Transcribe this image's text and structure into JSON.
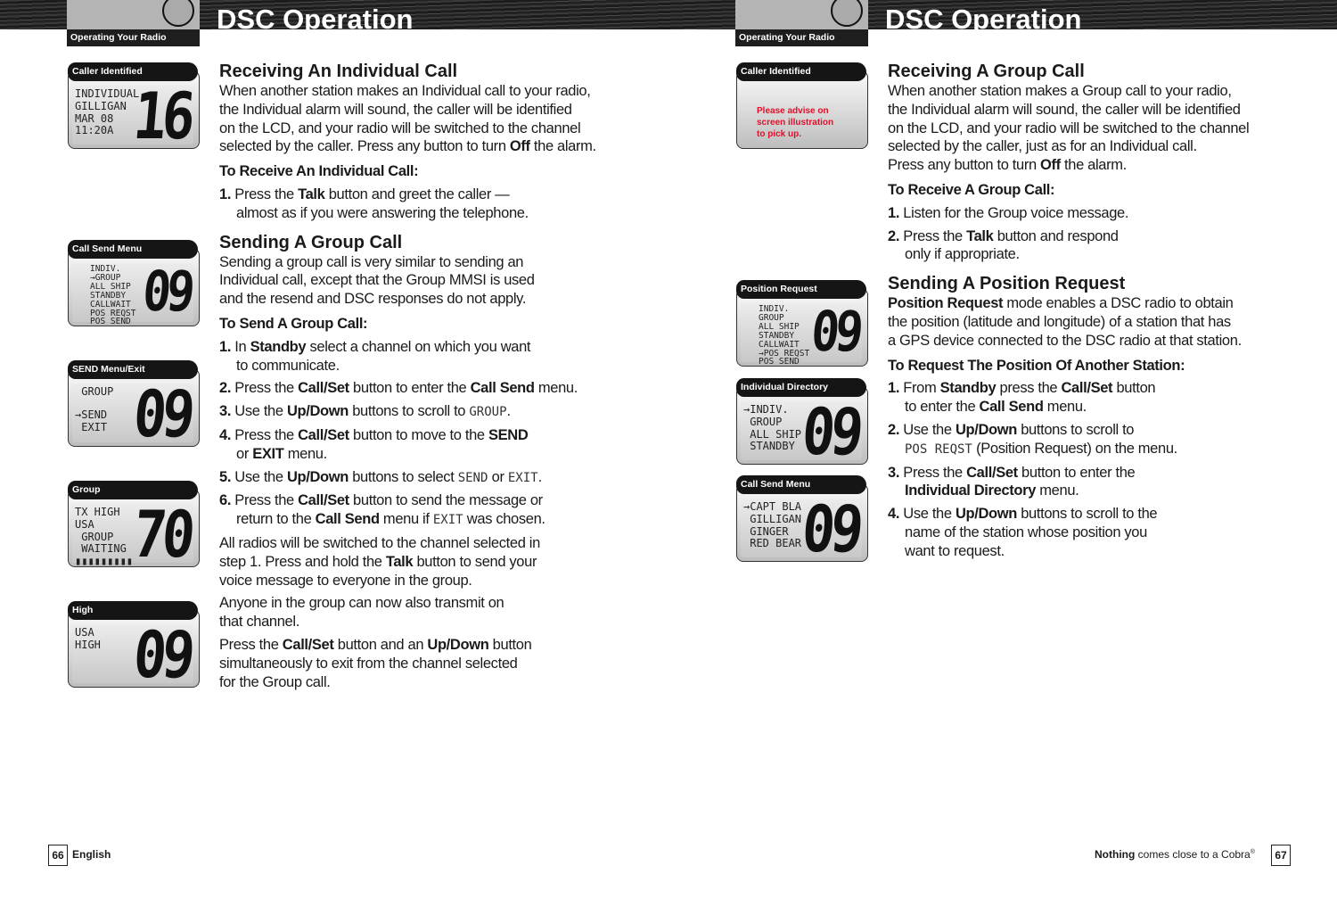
{
  "header": {
    "section_tab": "Operating Your Radio",
    "title": "DSC Operation"
  },
  "left": {
    "panels": [
      {
        "label": "Caller Identified",
        "lines": [
          "INDIVIDUAL",
          "GILLIGAN",
          "MAR 08",
          "11:20A"
        ],
        "channel": "16"
      },
      {
        "label": "Call Send Menu",
        "lines": [
          "INDIV.",
          "→GROUP",
          "ALL SHIP",
          "STANDBY",
          "CALLWAIT",
          "POS REQST",
          "POS SEND"
        ],
        "channel": "09"
      },
      {
        "label": "SEND Menu/Exit",
        "lines": [
          " GROUP",
          "",
          "→SEND",
          " EXIT"
        ],
        "channel": "09"
      },
      {
        "label": "Group",
        "lines": [
          "TX HIGH",
          "USA",
          " GROUP",
          " WAITING",
          "▮▮▮▮▮▮▮▮▮"
        ],
        "channel": "70"
      },
      {
        "label": "High",
        "lines": [
          "USA",
          "HIGH"
        ],
        "channel": "09"
      }
    ],
    "blocks": [
      {
        "type": "h",
        "text": "Receiving An Individual Call"
      },
      {
        "type": "p",
        "lines": [
          "When another station makes an Individual call to your radio,",
          "the Individual alarm will sound, the caller will be identified",
          "on the LCD, and your radio will be switched to the channel",
          "selected by the caller. Press any button to turn **Off** the alarm."
        ]
      },
      {
        "type": "sub",
        "text": "To Receive An Individual Call:"
      },
      {
        "type": "step",
        "lines": [
          "**1.** Press the **Talk** button and greet the caller —",
          "almost as if you were answering the telephone."
        ]
      },
      {
        "type": "h",
        "text": "Sending A Group Call"
      },
      {
        "type": "p",
        "lines": [
          "Sending a group call is very similar to sending an",
          "Individual call, except that the Group MMSI is used",
          "and the resend and DSC responses do not apply."
        ]
      },
      {
        "type": "sub",
        "text": "To Send A Group Call:"
      },
      {
        "type": "step",
        "lines": [
          "**1.** In **Standby** select a channel on which you want",
          "to communicate."
        ]
      },
      {
        "type": "step",
        "lines": [
          "**2.** Press the **Call/Set** button to enter the **Call Send** menu."
        ]
      },
      {
        "type": "step",
        "lines": [
          "**3.** Use the **Up/Down** buttons to scroll to `GROUP`."
        ]
      },
      {
        "type": "step",
        "lines": [
          "**4.** Press the **Call/Set** button to move to the **SEND**",
          "or **EXIT** menu."
        ]
      },
      {
        "type": "step",
        "lines": [
          "**5.** Use the **Up/Down** buttons to select `SEND` or `EXIT`."
        ]
      },
      {
        "type": "step",
        "lines": [
          "**6.** Press the **Call/Set** button to send the message or",
          "return to the **Call Send** menu if `EXIT` was chosen."
        ]
      },
      {
        "type": "p",
        "lines": [
          "All radios will be switched to the channel selected in",
          "step 1. Press and hold the **Talk** button to send your",
          "voice message to everyone in the group."
        ]
      },
      {
        "type": "p",
        "lines": [
          "Anyone in the group can now also transmit on",
          "that channel."
        ]
      },
      {
        "type": "p",
        "lines": [
          "Press the **Call/Set** button and an **Up/Down** button",
          "simultaneously to exit from the channel selected",
          "for the Group call."
        ]
      }
    ],
    "footer": {
      "page": "66",
      "language": "English"
    }
  },
  "right": {
    "panels": [
      {
        "label": "Caller Identified",
        "note": [
          "Please advise on",
          "screen illustration",
          "to pick up."
        ]
      },
      {
        "label": "Position Request",
        "lines": [
          "INDIV.",
          "GROUP",
          "ALL SHIP",
          "STANDBY",
          "CALLWAIT",
          "→POS REQST",
          "POS SEND"
        ],
        "channel": "09"
      },
      {
        "label": "Individual Directory",
        "lines": [
          "→INDIV.",
          " GROUP",
          " ALL SHIP",
          " STANDBY"
        ],
        "channel": "09"
      },
      {
        "label": "Call Send Menu",
        "lines": [
          "→CAPT BLA",
          " GILLIGAN",
          " GINGER",
          " RED BEAR"
        ],
        "channel": "09"
      }
    ],
    "blocks": [
      {
        "type": "h",
        "text": "Receiving A Group Call"
      },
      {
        "type": "p",
        "lines": [
          "When another station makes a Group call to your radio,",
          "the Individual alarm will sound, the caller will be identified",
          "on the LCD, and your radio will be switched to the channel",
          "selected by the caller, just as for an Individual call.",
          "Press any button to turn **Off** the alarm."
        ]
      },
      {
        "type": "sub",
        "text": "To Receive A Group Call:"
      },
      {
        "type": "step",
        "lines": [
          "**1.** Listen for the Group voice message."
        ]
      },
      {
        "type": "step",
        "lines": [
          "**2.** Press the **Talk** button and respond",
          "only if appropriate."
        ]
      },
      {
        "type": "h",
        "text": "Sending A Position Request"
      },
      {
        "type": "p",
        "lines": [
          "**Position Request** mode enables a DSC radio to obtain",
          "the position (latitude and longitude) of a station that has",
          "a GPS device connected to the DSC radio at that station."
        ]
      },
      {
        "type": "sub",
        "text": "To Request The Position Of Another Station:"
      },
      {
        "type": "step",
        "lines": [
          "**1.** From **Standby** press the **Call/Set** button",
          "to enter the **Call Send** menu."
        ]
      },
      {
        "type": "step",
        "lines": [
          "**2.** Use the **Up/Down** buttons to scroll to",
          "`POS REQST` (Position Request) on the menu."
        ]
      },
      {
        "type": "step",
        "lines": [
          "**3.** Press the **Call/Set** button to enter the",
          "**Individual Directory** menu."
        ]
      },
      {
        "type": "step",
        "lines": [
          "**4.** Use the **Up/Down** buttons to scroll to the",
          "name of the station whose position you",
          "want to request."
        ]
      }
    ],
    "footer": {
      "page": "67",
      "tagline_bold": "Nothing",
      "tagline": " comes close to a Cobra",
      "reg": "®"
    }
  }
}
